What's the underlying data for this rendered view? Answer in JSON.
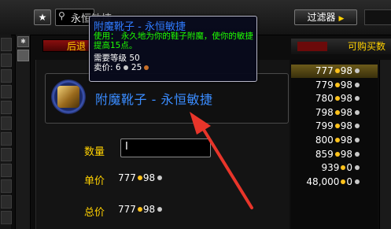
{
  "search": {
    "value": "永恒敏捷"
  },
  "top": {
    "filter_label": "过滤器"
  },
  "header": {
    "back_label": "后退",
    "right_label": "可购买数"
  },
  "item": {
    "name": "附魔靴子 - 永恒敏捷"
  },
  "form": {
    "quantity_label": "数量",
    "quantity_value": "I",
    "unit_price_label": "单价",
    "unit_price_gold": "777",
    "unit_price_silver": "98",
    "total_label": "总价",
    "total_gold": "777",
    "total_silver": "98"
  },
  "tooltip": {
    "title": "附魔靴子 - 永恒敏捷",
    "use_text": "使用： 永久地为你的鞋子附魔，使你的敏捷提高15点。",
    "req_text": "需要等级 50",
    "sell_label": "卖价:",
    "sell_silver": "6",
    "sell_copper": "25"
  },
  "price_list": [
    {
      "gold": "777",
      "silver": "98"
    },
    {
      "gold": "779",
      "silver": "98"
    },
    {
      "gold": "780",
      "silver": "98"
    },
    {
      "gold": "798",
      "silver": "98"
    },
    {
      "gold": "799",
      "silver": "98"
    },
    {
      "gold": "800",
      "silver": "98"
    },
    {
      "gold": "859",
      "silver": "98"
    },
    {
      "gold": "939",
      "silver": "0"
    },
    {
      "gold": "48,000",
      "silver": "0"
    }
  ],
  "colors": {
    "gold_text": "#ffd100",
    "item_blue": "#3a8cff",
    "tooltip_green": "#1eff00",
    "arrow_red": "#e8352a"
  },
  "icons": {
    "star": "star-icon",
    "search": "search-icon",
    "filter_arrow": "play-icon",
    "item": "boot-enchant-icon"
  }
}
